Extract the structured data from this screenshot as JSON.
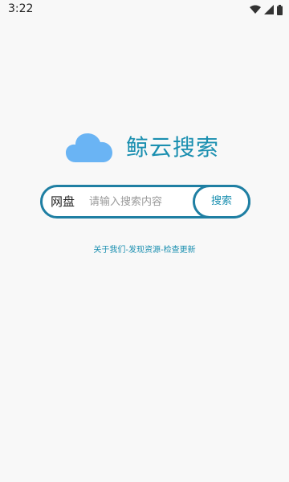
{
  "status_bar": {
    "time": "3:22",
    "icons": [
      "wifi-icon",
      "signal-icon",
      "battery-icon"
    ]
  },
  "app": {
    "title": "鲸云搜索",
    "logo_icon": "cloud-icon",
    "accent_color": "#1a8fb0",
    "cloud_color": "#6ab4f4"
  },
  "search": {
    "category_label": "网盘",
    "placeholder": "请输入搜索内容",
    "value": "",
    "button_label": "搜索"
  },
  "footer": {
    "about": "关于我们",
    "sep1": "-",
    "discover": "发现资源",
    "sep2": "-",
    "check_update": "检查更新"
  }
}
